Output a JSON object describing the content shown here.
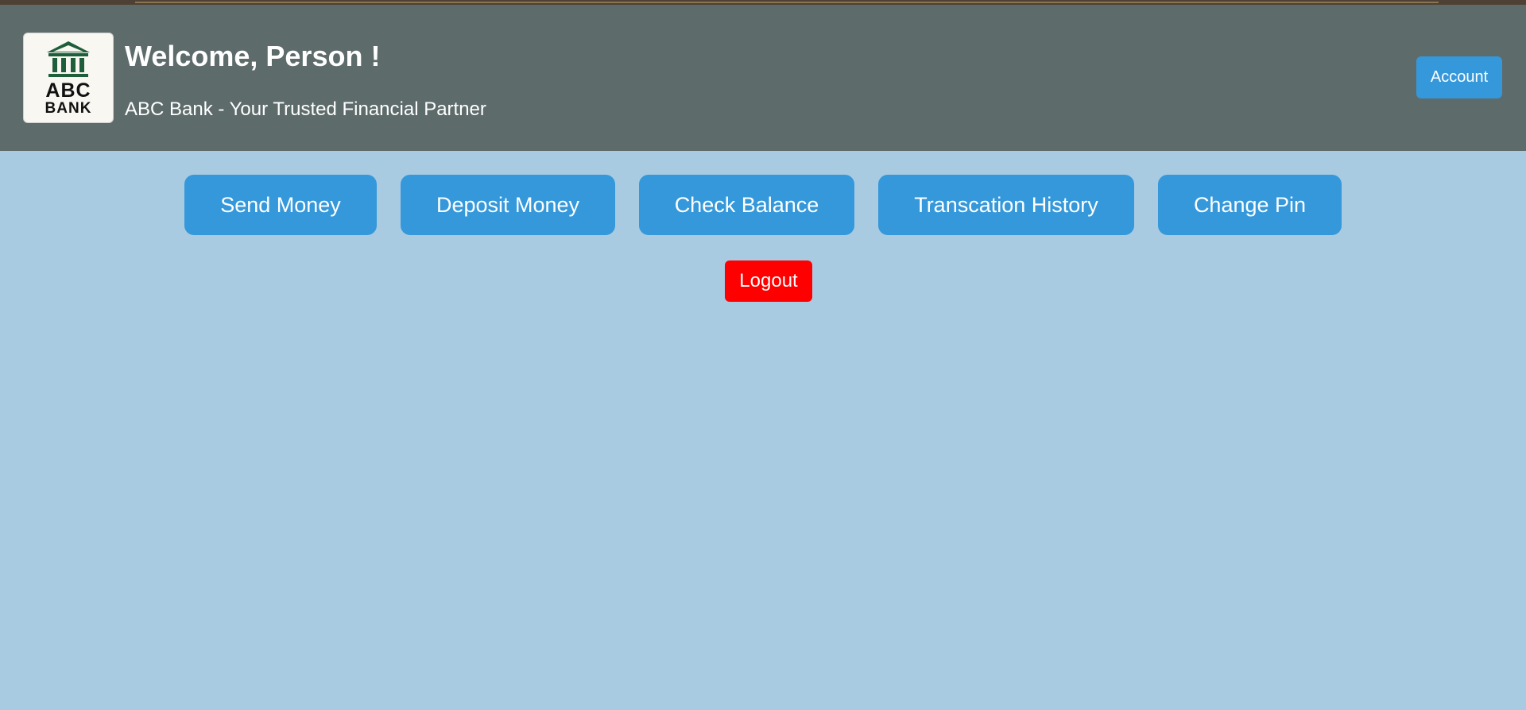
{
  "header": {
    "logo": {
      "icon": "bank-building-icon",
      "line1": "ABC",
      "line2": "BANK",
      "icon_color": "#1f5e3a"
    },
    "welcome": "Welcome, Person !",
    "tagline": "ABC Bank - Your Trusted Financial Partner",
    "account_label": "Account"
  },
  "actions": [
    {
      "label": "Send Money"
    },
    {
      "label": "Deposit Money"
    },
    {
      "label": "Check Balance"
    },
    {
      "label": "Transcation History"
    },
    {
      "label": "Change Pin"
    }
  ],
  "logout_label": "Logout",
  "colors": {
    "header_bg": "#5e6b6b",
    "page_bg": "#a9cbe2",
    "accent": "#3498db",
    "logout": "#ff0000"
  }
}
